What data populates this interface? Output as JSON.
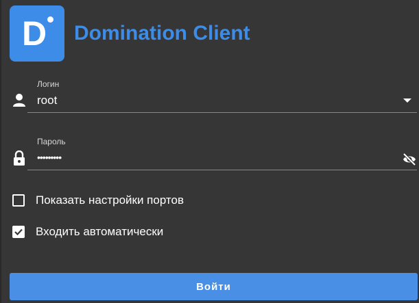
{
  "app": {
    "title": "Domination Client",
    "logo_letter": "D"
  },
  "login": {
    "label": "Логин",
    "value": "root",
    "icon": "person-icon"
  },
  "password": {
    "label": "Пароль",
    "value": "•••••••••",
    "icon": "lock-icon",
    "toggle_icon": "eye-off-icon"
  },
  "options": {
    "show_ports": {
      "label": "Показать настройки портов",
      "checked": false
    },
    "auto_login": {
      "label": "Входить автоматически",
      "checked": true
    }
  },
  "submit": {
    "label": "Войти"
  },
  "colors": {
    "accent": "#3d8ce8",
    "background": "#363636",
    "button": "#4a8fe6"
  }
}
